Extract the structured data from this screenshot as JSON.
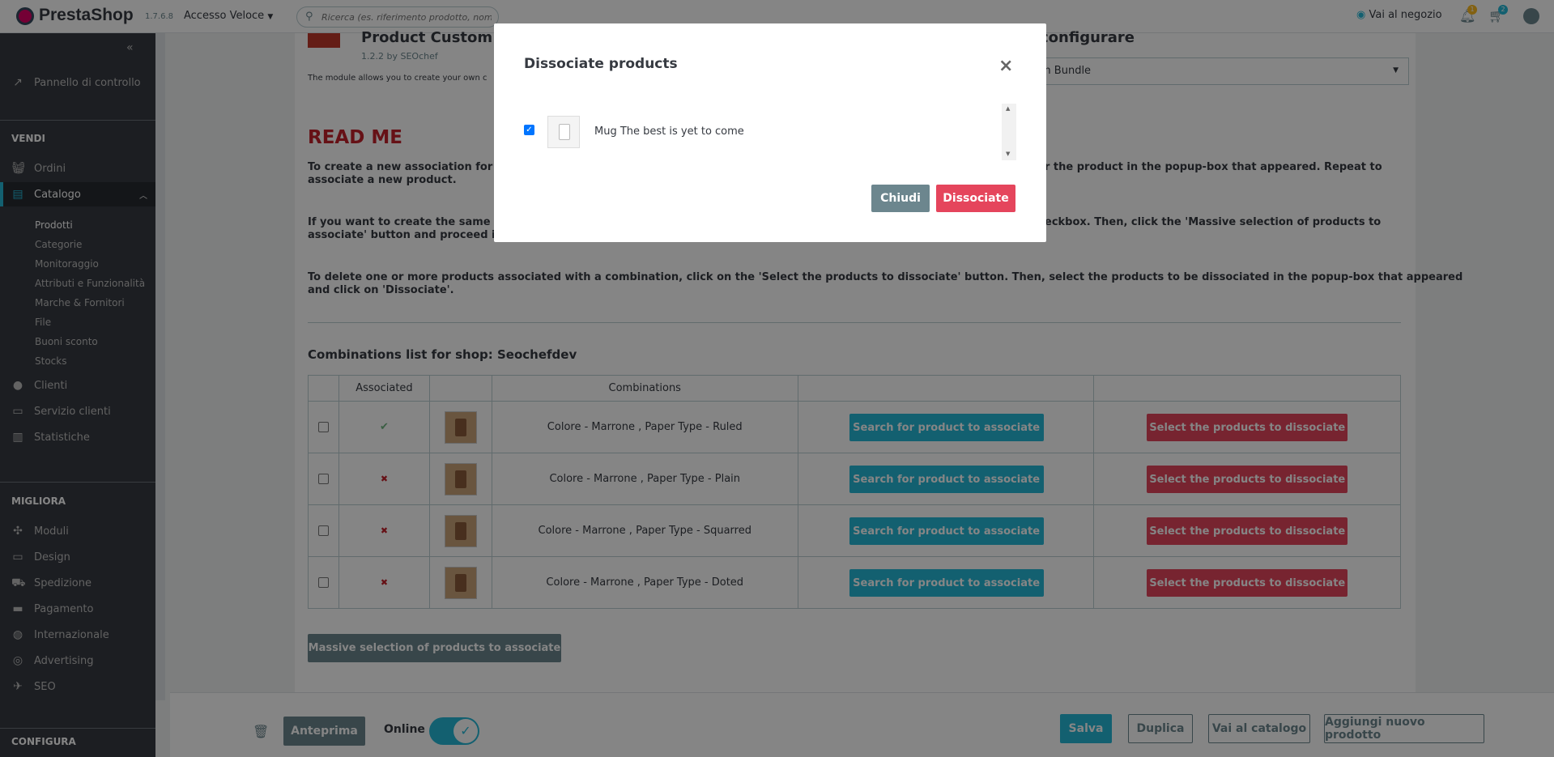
{
  "topbar": {
    "brand": "PrestaShop",
    "version": "1.7.6.8",
    "quick_access": "Accesso Veloce",
    "search_placeholder": "Ricerca (es. riferimento prodotto, nome",
    "shop_link": "Vai al negozio",
    "notif_count_1": "1",
    "notif_count_2": "2"
  },
  "sidebar": {
    "dashboard": "Pannello di controllo",
    "sell_head": "VENDI",
    "orders": "Ordini",
    "catalog": "Catalogo",
    "catalog_sub": [
      "Prodotti",
      "Categorie",
      "Monitoraggio",
      "Attributi e Funzionalità",
      "Marche & Fornitori",
      "File",
      "Buoni sconto",
      "Stocks"
    ],
    "customers": "Clienti",
    "service": "Servizio clienti",
    "stats": "Statistiche",
    "improve_head": "MIGLIORA",
    "improve_items": [
      "Moduli",
      "Design",
      "Spedizione",
      "Pagamento",
      "Internazionale",
      "Advertising",
      "SEO"
    ],
    "configure_head": "CONFIGURA"
  },
  "module": {
    "title": "Product Custom Bu",
    "version": "1.2.2 by SEOchef",
    "desc": "The module allows you to create your own c",
    "configure_title": "configurare",
    "select_value": "m Bundle"
  },
  "readme": {
    "title": "READ ME",
    "p1a": "To create a new association for a",
    "p1b": "r the product in the popup-box that appeared. Repeat to",
    "p1c": "associate a new product.",
    "p2a": "If you want to create the same as",
    "p2b": "eckbox. Then, click the 'Massive selection of products to",
    "p2c": "associate' button and proceed in",
    "p3a": "To delete one or more products associated with a combination, click on the 'Select the products to dissociate' button. Then, select the products to be dissociated in the popup-box that appeared",
    "p3b": "and click on 'Dissociate'."
  },
  "combinations": {
    "title": "Combinations list for shop: Seochefdev",
    "headers": [
      "",
      "Associated",
      "",
      "Combinations",
      "",
      ""
    ],
    "search_label": "Search for product to associate",
    "dissociate_label": "Select the products to dissociate",
    "rows": [
      {
        "name": "Colore - Marrone ,  Paper Type - Ruled",
        "associated": "✔"
      },
      {
        "name": "Colore - Marrone ,  Paper Type - Plain",
        "associated": "✖"
      },
      {
        "name": "Colore - Marrone ,  Paper Type - Squarred",
        "associated": "✖"
      },
      {
        "name": "Colore - Marrone ,  Paper Type - Doted",
        "associated": "✖"
      }
    ],
    "massive_button": "Massive selection of products to associate"
  },
  "footer": {
    "preview": "Anteprima",
    "online": "Online",
    "save": "Salva",
    "duplicate": "Duplica",
    "catalog": "Vai al catalogo",
    "new_product": "Aggiungi nuovo prodotto"
  },
  "modal": {
    "title": "Dissociate products",
    "item": "Mug The best is yet to come",
    "close_label": "Chiudi",
    "dissociate_label": "Dissociate"
  }
}
